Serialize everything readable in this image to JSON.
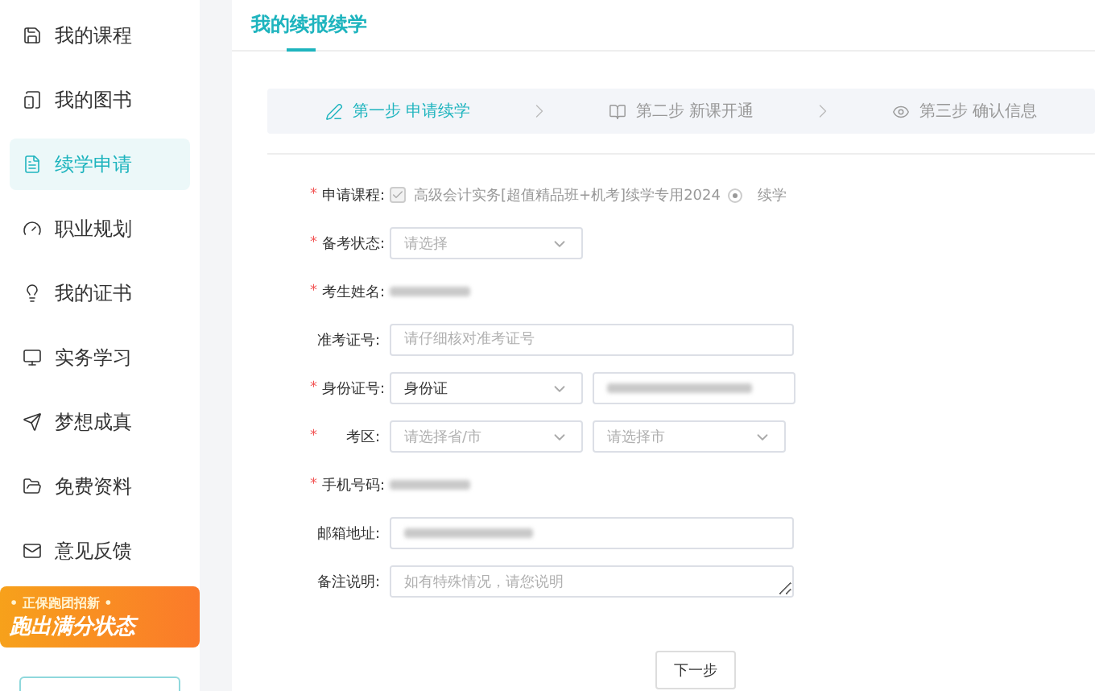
{
  "sidebar": {
    "items": [
      {
        "label": "我的课程",
        "selected": false
      },
      {
        "label": "我的图书",
        "selected": false
      },
      {
        "label": "续学申请",
        "selected": true
      },
      {
        "label": "职业规划",
        "selected": false
      },
      {
        "label": "我的证书",
        "selected": false
      },
      {
        "label": "实务学习",
        "selected": false
      },
      {
        "label": "梦想成真",
        "selected": false
      },
      {
        "label": "免费资料",
        "selected": false
      },
      {
        "label": "意见反馈",
        "selected": false
      }
    ],
    "banner": {
      "top": "• 正保跑团招新 •",
      "main": "跑出满分状态"
    }
  },
  "page": {
    "tab": "我的续报续学"
  },
  "steps": [
    {
      "label": "第一步 申请续学",
      "active": true
    },
    {
      "label": "第二步 新课开通",
      "active": false
    },
    {
      "label": "第三步 确认信息",
      "active": false
    }
  ],
  "form": [
    {
      "kind": "course",
      "mark": "*",
      "label": "申请课程:",
      "course": "高级会计实务[超值精品班+机考]续学专用2024",
      "checked": true,
      "option": "续学",
      "option_selected": true
    },
    {
      "kind": "select",
      "mark": "*",
      "label": "备考状态:",
      "placeholder": "请选择"
    },
    {
      "kind": "hidden",
      "mark": "*",
      "label": "考生姓名:"
    },
    {
      "kind": "input",
      "label": "准考证号:",
      "placeholder": "请仔细核对准考证号"
    },
    {
      "kind": "id",
      "mark": "*",
      "label": "身份证号:",
      "value": "身份证"
    },
    {
      "kind": "region",
      "mark": "*",
      "label": "考区:",
      "placeholder": "请选择省/市",
      "placeholder2": "请选择市"
    },
    {
      "kind": "hidden",
      "mark": "*",
      "label": "手机号码:"
    },
    {
      "kind": "hiddeninput",
      "label": "邮箱地址:"
    },
    {
      "kind": "textarea",
      "label": "备注说明:",
      "placeholder": "如有特殊情况，请您说明"
    }
  ],
  "next_button": "下一步"
}
